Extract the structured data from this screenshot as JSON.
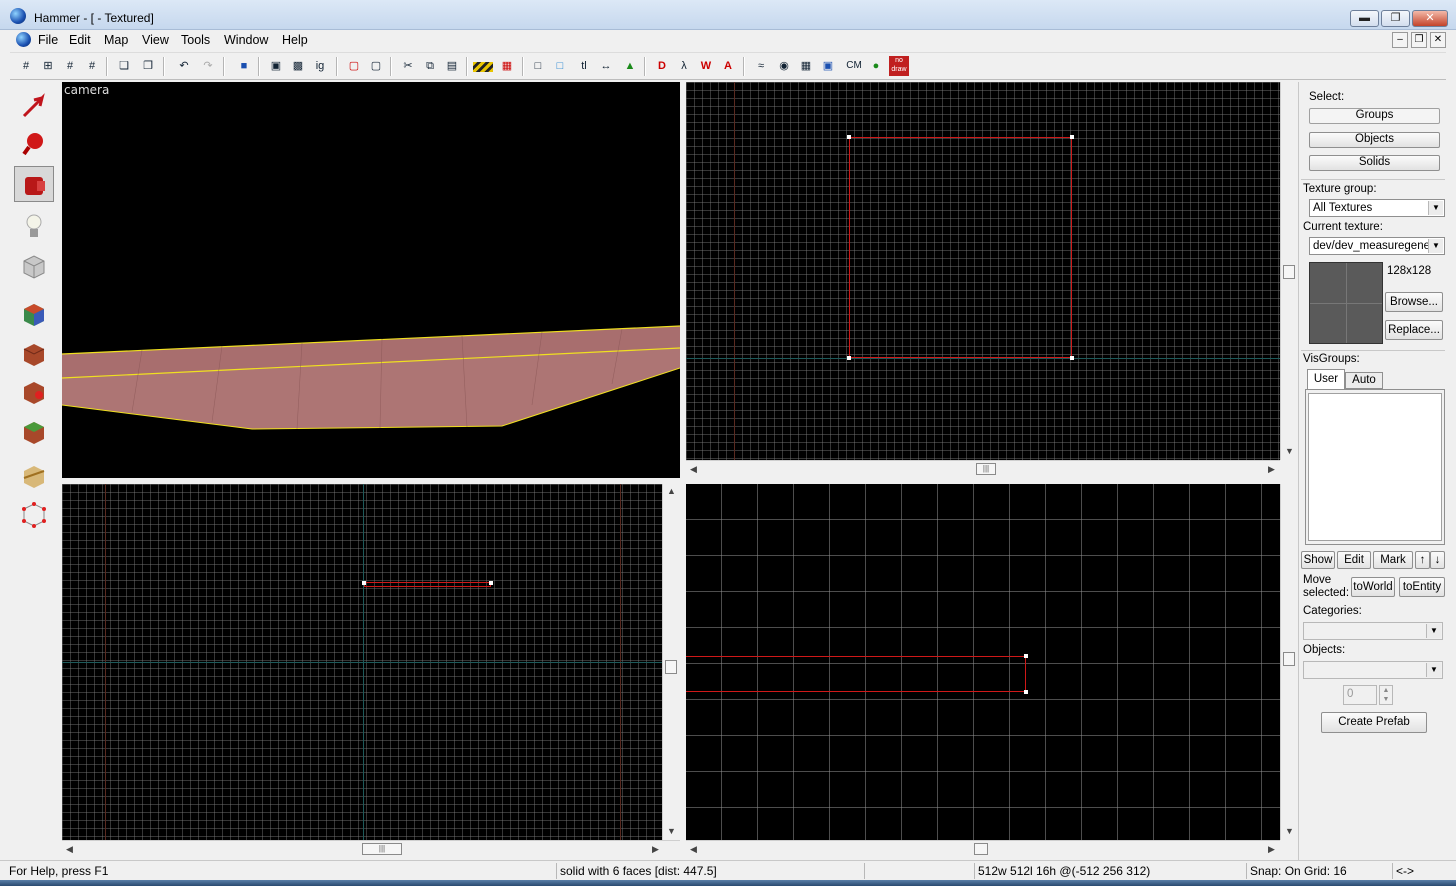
{
  "window": {
    "title": "Hammer - [ - Textured]",
    "caption_buttons": [
      "minimize",
      "restore",
      "close"
    ]
  },
  "menu": {
    "items": [
      "File",
      "Edit",
      "Map",
      "View",
      "Tools",
      "Window",
      "Help"
    ]
  },
  "toolbar": {
    "labels": {
      "texture_lock": "tl",
      "ig": "ig",
      "cubemap": "CM",
      "nodraw": "no draw"
    }
  },
  "tools": [
    "selection-tool",
    "magnify-tool",
    "camera-tool",
    "entity-tool",
    "block-tool",
    "toggle-texture-tool",
    "apply-texture-tool",
    "decal-tool",
    "overlay-tool",
    "clipping-tool",
    "vertex-tool"
  ],
  "viewports": {
    "camera": {
      "label": "camera"
    }
  },
  "right_panel": {
    "select": {
      "label": "Select:",
      "groups": "Groups",
      "objects": "Objects",
      "solids": "Solids"
    },
    "texture_group": {
      "label": "Texture group:",
      "value": "All Textures"
    },
    "current_texture": {
      "label": "Current texture:",
      "value": "dev/dev_measuregene",
      "size": "128x128"
    },
    "browse": "Browse...",
    "replace": "Replace...",
    "visgroups": {
      "label": "VisGroups:",
      "tab_user": "User",
      "tab_auto": "Auto",
      "show": "Show",
      "edit": "Edit",
      "mark": "Mark"
    },
    "move_selected": {
      "label_line1": "Move",
      "label_line2": "selected:",
      "to_world": "toWorld",
      "to_entity": "toEntity"
    },
    "categories": {
      "label": "Categories:"
    },
    "objects": {
      "label": "Objects:",
      "count": "0"
    },
    "create_prefab": "Create Prefab"
  },
  "status": {
    "help": "For Help, press F1",
    "selection": "solid with 6 faces   [dist: 447.5]",
    "size": "512w 512l 16h @(-512 256 312)",
    "snap": "Snap: On Grid: 16",
    "arrow": "<->"
  }
}
